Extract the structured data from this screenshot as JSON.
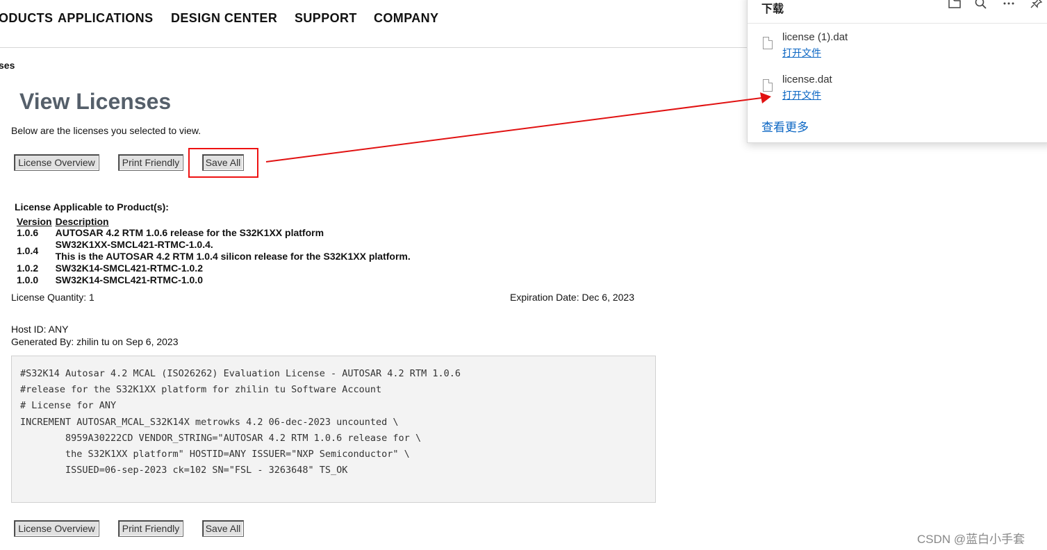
{
  "nav": {
    "items": [
      "ODUCTS",
      "APPLICATIONS",
      "DESIGN CENTER",
      "SUPPORT",
      "COMPANY"
    ]
  },
  "breadcrumb": "ses",
  "page": {
    "title": "View Licenses",
    "intro": "Below are the licenses you selected to view."
  },
  "buttons": {
    "overview": "License Overview",
    "print": "Print Friendly",
    "save_all": "Save All"
  },
  "license": {
    "heading": "License Applicable to Product(s):",
    "columns": [
      "Version",
      "Description"
    ],
    "rows": [
      {
        "version": "1.0.6",
        "description": "AUTOSAR 4.2 RTM 1.0.6 release for the S32K1XX platform"
      },
      {
        "version": "1.0.4",
        "description": "SW32K1XX-SMCL421-RTMC-1.0.4.",
        "description2": "This is the AUTOSAR 4.2 RTM 1.0.4 silicon release for the S32K1XX platform."
      },
      {
        "version": "1.0.2",
        "description": "SW32K14-SMCL421-RTMC-1.0.2"
      },
      {
        "version": "1.0.0",
        "description": "SW32K14-SMCL421-RTMC-1.0.0"
      }
    ],
    "quantity": "License Quantity: 1",
    "expiration": "Expiration Date: Dec 6, 2023",
    "host_id": "Host ID: ANY",
    "generated_by": "Generated By: zhilin tu on Sep 6, 2023",
    "text": "#S32K14 Autosar 4.2 MCAL (ISO26262) Evaluation License - AUTOSAR 4.2 RTM 1.0.6\n#release for the S32K1XX platform for zhilin tu Software Account\n# License for ANY\nINCREMENT AUTOSAR_MCAL_S32K14X metrowks 4.2 06-dec-2023 uncounted \\\n        8959A30222CD VENDOR_STRING=\"AUTOSAR 4.2 RTM 1.0.6 release for \\\n        the S32K1XX platform\" HOSTID=ANY ISSUER=\"NXP Semiconductor\" \\\n        ISSUED=06-sep-2023 ck=102 SN=\"FSL - 3263648\" TS_OK"
  },
  "downloads": {
    "title": "下载",
    "items": [
      {
        "file": "license (1).dat",
        "action": "打开文件"
      },
      {
        "file": "license.dat",
        "action": "打开文件"
      }
    ],
    "see_more": "查看更多",
    "icons": [
      "folder-icon",
      "search-icon",
      "more-icon",
      "pin-icon"
    ]
  },
  "annotation": {
    "color": "#e11111"
  },
  "watermark": "CSDN @蓝白小手套"
}
